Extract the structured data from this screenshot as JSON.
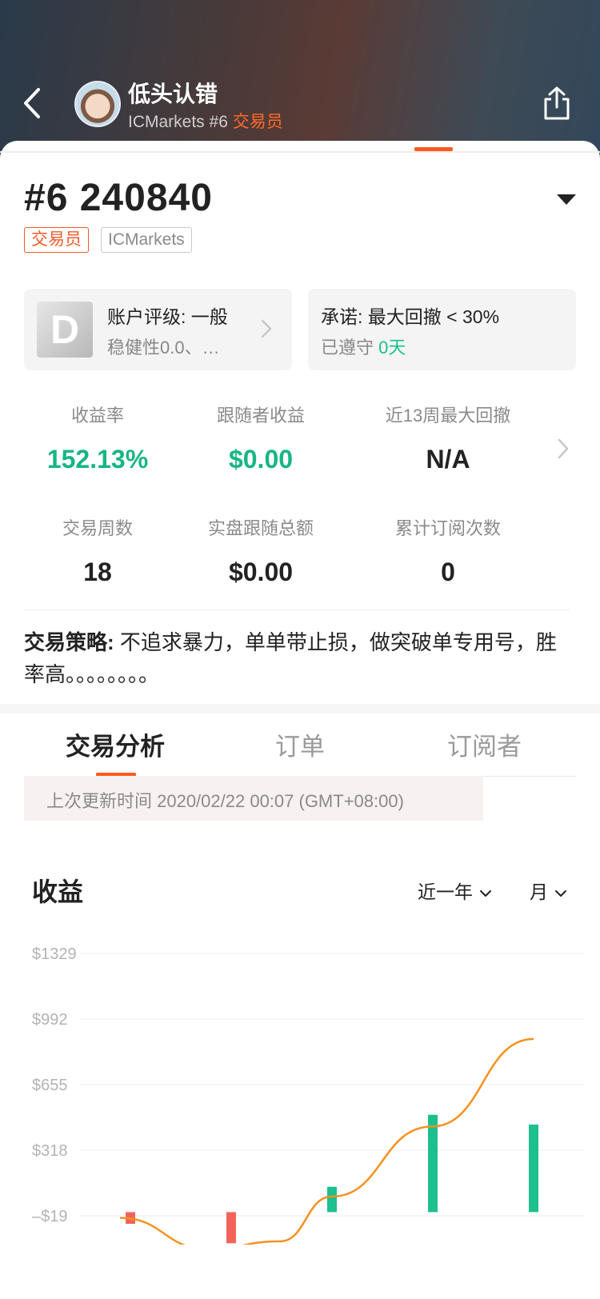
{
  "header": {
    "name": "低头认错",
    "broker": "ICMarkets",
    "rank": "#6",
    "role": "交易员"
  },
  "account": {
    "title": "#6 240840",
    "tags": [
      "交易员",
      "ICMarkets"
    ]
  },
  "rating": {
    "grade": "D",
    "label": "账户评级: 一般",
    "sub": "稳健性0.0、…"
  },
  "commitment": {
    "label": "承诺: 最大回撤 < 30%",
    "kept_prefix": "已遵守 ",
    "kept_days": "0天"
  },
  "stats": [
    {
      "label": "收益率",
      "value": "152.13%",
      "color": "green"
    },
    {
      "label": "跟随者收益",
      "value": "$0.00",
      "color": "green"
    },
    {
      "label": "近13周最大回撤",
      "value": "N/A",
      "color": "dark"
    },
    {
      "label": "交易周数",
      "value": "18",
      "color": "dark"
    },
    {
      "label": "实盘跟随总额",
      "value": "$0.00",
      "color": "dark"
    },
    {
      "label": "累计订阅次数",
      "value": "0",
      "color": "dark"
    }
  ],
  "strategy": {
    "label": "交易策略:",
    "text": " 不追求暴力，单单带止损，做突破单专用号，胜率高。。。。。。。。"
  },
  "tabs": [
    "交易分析",
    "订单",
    "订阅者"
  ],
  "updated": "上次更新时间 2020/02/22 00:07 (GMT+08:00)",
  "chart_section": {
    "title": "收益",
    "range_select": "近一年",
    "period_select": "月"
  },
  "colors": {
    "accent": "#ff5a1f",
    "positive": "#17b584",
    "bar_positive": "#1cbf8e",
    "bar_negative": "#f2645a",
    "line": "#f5921e"
  },
  "chart_data": {
    "type": "bar",
    "y_ticks": [
      "$1329",
      "$992",
      "$655",
      "$318",
      "–$19"
    ],
    "ylim": [
      -150,
      1329
    ],
    "bars": [
      -60,
      -160,
      130,
      500,
      450
    ],
    "line": [
      -30,
      -190,
      -150,
      80,
      440,
      890
    ]
  }
}
